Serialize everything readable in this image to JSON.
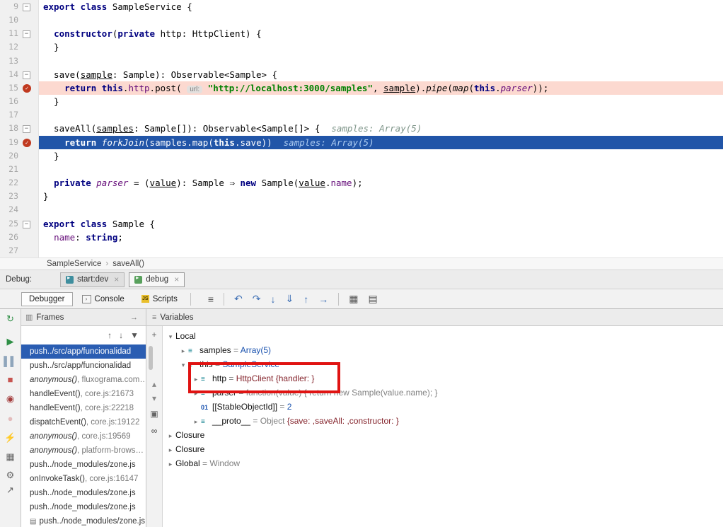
{
  "editor": {
    "lines": [
      {
        "num": 9,
        "fold": true,
        "segs": [
          [
            "kw",
            "export class"
          ],
          [
            "pl",
            " SampleService {"
          ]
        ]
      },
      {
        "num": 10,
        "segs": []
      },
      {
        "num": 11,
        "fold": true,
        "segs": [
          [
            "pl",
            "  "
          ],
          [
            "kw",
            "constructor"
          ],
          [
            "pl",
            "("
          ],
          [
            "kw",
            "private"
          ],
          [
            "pl",
            " http: HttpClient) {"
          ]
        ]
      },
      {
        "num": 12,
        "segs": [
          [
            "pl",
            "  }"
          ]
        ]
      },
      {
        "num": 13,
        "segs": []
      },
      {
        "num": 14,
        "fold": true,
        "segs": [
          [
            "pl",
            "  save("
          ],
          [
            "par",
            "sample"
          ],
          [
            "pl",
            ": Sample): Observable<Sample> {"
          ]
        ]
      },
      {
        "num": 15,
        "bp": true,
        "bg": "pink",
        "segs": [
          [
            "pl",
            "    "
          ],
          [
            "kw",
            "return "
          ],
          [
            "kw",
            "this"
          ],
          [
            "pl",
            "."
          ],
          [
            "fld",
            "http"
          ],
          [
            "pl",
            ".post( "
          ],
          [
            "hint",
            "url:"
          ],
          [
            "pl",
            " "
          ],
          [
            "str",
            "\"http://localhost:3000/samples\""
          ],
          [
            "pl",
            ", "
          ],
          [
            "par",
            "sample"
          ],
          [
            "pl",
            ")."
          ],
          [
            "fn",
            "pipe"
          ],
          [
            "pl",
            "("
          ],
          [
            "fn",
            "map"
          ],
          [
            "pl",
            "("
          ],
          [
            "kw",
            "this"
          ],
          [
            "pl",
            "."
          ],
          [
            "fli",
            "parser"
          ],
          [
            "pl",
            "));"
          ]
        ]
      },
      {
        "num": 16,
        "segs": [
          [
            "pl",
            "  }"
          ]
        ]
      },
      {
        "num": 17,
        "segs": []
      },
      {
        "num": 18,
        "fold": true,
        "segs": [
          [
            "pl",
            "  saveAll("
          ],
          [
            "par",
            "samples"
          ],
          [
            "pl",
            ": Sample[]): Observable<Sample[]> {"
          ],
          [
            "dbg",
            "samples: Array(5)"
          ]
        ]
      },
      {
        "num": 19,
        "bp": true,
        "bg": "blue",
        "segs": [
          [
            "wpl",
            "    "
          ],
          [
            "wkw",
            "return "
          ],
          [
            "wfn",
            "forkJoin"
          ],
          [
            "wpl",
            "(samples.map("
          ],
          [
            "wkw",
            "this"
          ],
          [
            "wpl",
            ".save))"
          ],
          [
            "wdbg",
            "samples: Array(5)"
          ]
        ]
      },
      {
        "num": 20,
        "segs": [
          [
            "pl",
            "  }"
          ]
        ]
      },
      {
        "num": 21,
        "segs": []
      },
      {
        "num": 22,
        "segs": [
          [
            "pl",
            "  "
          ],
          [
            "kw",
            "private "
          ],
          [
            "fli",
            "parser"
          ],
          [
            "pl",
            " = ("
          ],
          [
            "par",
            "value"
          ],
          [
            "pl",
            "): Sample ⇒ "
          ],
          [
            "kw",
            "new "
          ],
          [
            "pl",
            "Sample("
          ],
          [
            "par",
            "value"
          ],
          [
            "pl",
            "."
          ],
          [
            "fld",
            "name"
          ],
          [
            "pl",
            ");"
          ]
        ]
      },
      {
        "num": 23,
        "segs": [
          [
            "pl",
            "}"
          ]
        ]
      },
      {
        "num": 24,
        "segs": []
      },
      {
        "num": 25,
        "fold": true,
        "segs": [
          [
            "kw",
            "export class"
          ],
          [
            "pl",
            " Sample {"
          ]
        ]
      },
      {
        "num": 26,
        "segs": [
          [
            "pl",
            "  "
          ],
          [
            "fld",
            "name"
          ],
          [
            "pl",
            ": "
          ],
          [
            "kw",
            "string"
          ],
          [
            "pl",
            ";"
          ]
        ]
      },
      {
        "num": 27,
        "segs": []
      }
    ]
  },
  "breadcrumb": {
    "items": [
      "SampleService",
      "saveAll()"
    ],
    "separator": "›"
  },
  "debug_bar": {
    "label": "Debug:",
    "tabs": [
      {
        "label": "start:dev",
        "close": "×"
      },
      {
        "label": "debug",
        "close": "×",
        "selected": true
      }
    ]
  },
  "toolbar": {
    "tabs": [
      {
        "label": "Debugger",
        "selected": true
      },
      {
        "label": "Console",
        "icon_text": "›"
      },
      {
        "label": "Scripts",
        "icon_text": "JS"
      }
    ],
    "icons": [
      {
        "name": "view-options-icon",
        "glyph": "≡",
        "color": "#555"
      },
      {
        "sep": true
      },
      {
        "name": "show-execution-point-icon",
        "glyph": "↶",
        "color": "#3c6eb4"
      },
      {
        "name": "step-over-icon",
        "glyph": "↷",
        "color": "#3c6eb4"
      },
      {
        "name": "step-into-icon",
        "glyph": "↓",
        "color": "#3c6eb4"
      },
      {
        "name": "force-step-into-icon",
        "glyph": "⇓",
        "color": "#3c6eb4"
      },
      {
        "name": "step-out-icon",
        "glyph": "↑",
        "color": "#3c6eb4"
      },
      {
        "name": "run-to-cursor-icon",
        "glyph": "→",
        "color": "#3c6eb4"
      },
      {
        "sep": true
      },
      {
        "name": "view-breakpoints-table-icon",
        "glyph": "▦",
        "color": "#555"
      },
      {
        "name": "mute-breakpoints-panel-icon",
        "glyph": "▤",
        "color": "#555"
      }
    ]
  },
  "left_toolbar": [
    {
      "name": "rerun-icon",
      "glyph": "↻",
      "color": "#2f8f46"
    },
    {
      "name": "resume-icon",
      "glyph": "▶",
      "color": "#2f8f46"
    },
    {
      "name": "pause-icon",
      "glyph": "▌▌",
      "color": "#8fa5bb"
    },
    {
      "name": "stop-icon",
      "glyph": "■",
      "color": "#c75450"
    },
    {
      "name": "view-breakpoints-icon",
      "glyph": "◉",
      "color": "#a33c3c"
    },
    {
      "name": "mute-breakpoints-icon",
      "glyph": "●",
      "color": "#e3bcbc"
    },
    {
      "name": "lightning-icon",
      "glyph": "⚡",
      "color": "#d9a521"
    },
    {
      "name": "layout-grid-icon",
      "glyph": "▦",
      "color": "#666"
    },
    {
      "name": "settings-gear-icon",
      "glyph": "⚙",
      "color": "#666"
    },
    {
      "name": "pin-arrow-icon",
      "glyph": "↗",
      "color": "#666"
    }
  ],
  "frames": {
    "title": "Frames",
    "panel_icon": "▥",
    "pin_icon": "→",
    "nav_icons": [
      {
        "name": "prev-frame-icon",
        "glyph": "↑"
      },
      {
        "name": "next-frame-icon",
        "glyph": "↓"
      },
      {
        "name": "filter-frames-icon",
        "glyph": "▼"
      }
    ],
    "items": [
      {
        "name": "push../src/app/funcionalidad",
        "selected": true
      },
      {
        "name": "push../src/app/funcionalidad"
      },
      {
        "name": "anonymous()",
        "loc": ", fluxograma.com…",
        "italic": true
      },
      {
        "name": "handleEvent()",
        "loc": ", core.js:21673"
      },
      {
        "name": "handleEvent()",
        "loc": ", core.js:22218"
      },
      {
        "name": "dispatchEvent()",
        "loc": ", core.js:19122"
      },
      {
        "name": "anonymous()",
        "loc": ", core.js:19569",
        "italic": true
      },
      {
        "name": "anonymous()",
        "loc": ", platform-brows…",
        "italic": true
      },
      {
        "name": "push../node_modules/zone.js"
      },
      {
        "name": "onInvokeTask()",
        "loc": ", core.js:16147"
      },
      {
        "name": "push../node_modules/zone.js"
      },
      {
        "name": "push../node_modules/zone.js"
      },
      {
        "name": "push../node_modules/zone.js",
        "icon": true
      }
    ]
  },
  "watch_strip": [
    {
      "name": "add-watch-icon",
      "glyph": "+",
      "color": "#666"
    },
    {
      "name": "scroll-up-icon",
      "glyph": "▴",
      "color": "#888"
    },
    {
      "name": "scroll-down-icon",
      "glyph": "▾",
      "color": "#888"
    },
    {
      "name": "copy-stack-icon",
      "glyph": "▣",
      "color": "#666"
    },
    {
      "name": "show-watches-icon",
      "glyph": "∞",
      "color": "#444"
    }
  ],
  "variables": {
    "title": "Variables",
    "menu_icon": "≡",
    "rows": [
      {
        "indent": 0,
        "chevron": "v",
        "name": "Local",
        "value_parts": []
      },
      {
        "indent": 1,
        "chevron": ">",
        "icon": "var",
        "name": "samples",
        "value_parts": [
          [
            "eq",
            " = "
          ],
          [
            "navy",
            "Array(5)"
          ]
        ]
      },
      {
        "indent": 1,
        "chevron": "v",
        "icon": "var",
        "name": "this",
        "value_parts": [
          [
            "eq",
            " = "
          ],
          [
            "navy",
            "SampleService"
          ]
        ]
      },
      {
        "indent": 2,
        "chevron": ">",
        "icon": "var",
        "name": "http",
        "value_parts": [
          [
            "eq",
            " = "
          ],
          [
            "maroon",
            "HttpClient {handler: }"
          ]
        ]
      },
      {
        "indent": 2,
        "chevron": ">",
        "icon": "var",
        "name": "parser",
        "value_parts": [
          [
            "eq",
            " = "
          ],
          [
            "gray",
            "function(value) { return new Sample(value.name); }"
          ]
        ]
      },
      {
        "indent": 2,
        "chevron": null,
        "icon": "id",
        "name": "[[StableObjectId]]",
        "value_parts": [
          [
            "eq",
            " = "
          ],
          [
            "navy",
            "2"
          ]
        ]
      },
      {
        "indent": 2,
        "chevron": ">",
        "icon": "var",
        "name": "__proto__",
        "value_parts": [
          [
            "eq",
            " = "
          ],
          [
            "gray",
            "Object "
          ],
          [
            "maroon",
            "{save: ,saveAll: ,constructor: }"
          ]
        ]
      },
      {
        "indent": 0,
        "chevron": ">",
        "name": "Closure",
        "value_parts": []
      },
      {
        "indent": 0,
        "chevron": ">",
        "name": "Closure",
        "value_parts": []
      },
      {
        "indent": 0,
        "chevron": ">",
        "name": "Global",
        "value_parts": [
          [
            "eq",
            " = "
          ],
          [
            "gray",
            "Window"
          ]
        ]
      }
    ]
  }
}
